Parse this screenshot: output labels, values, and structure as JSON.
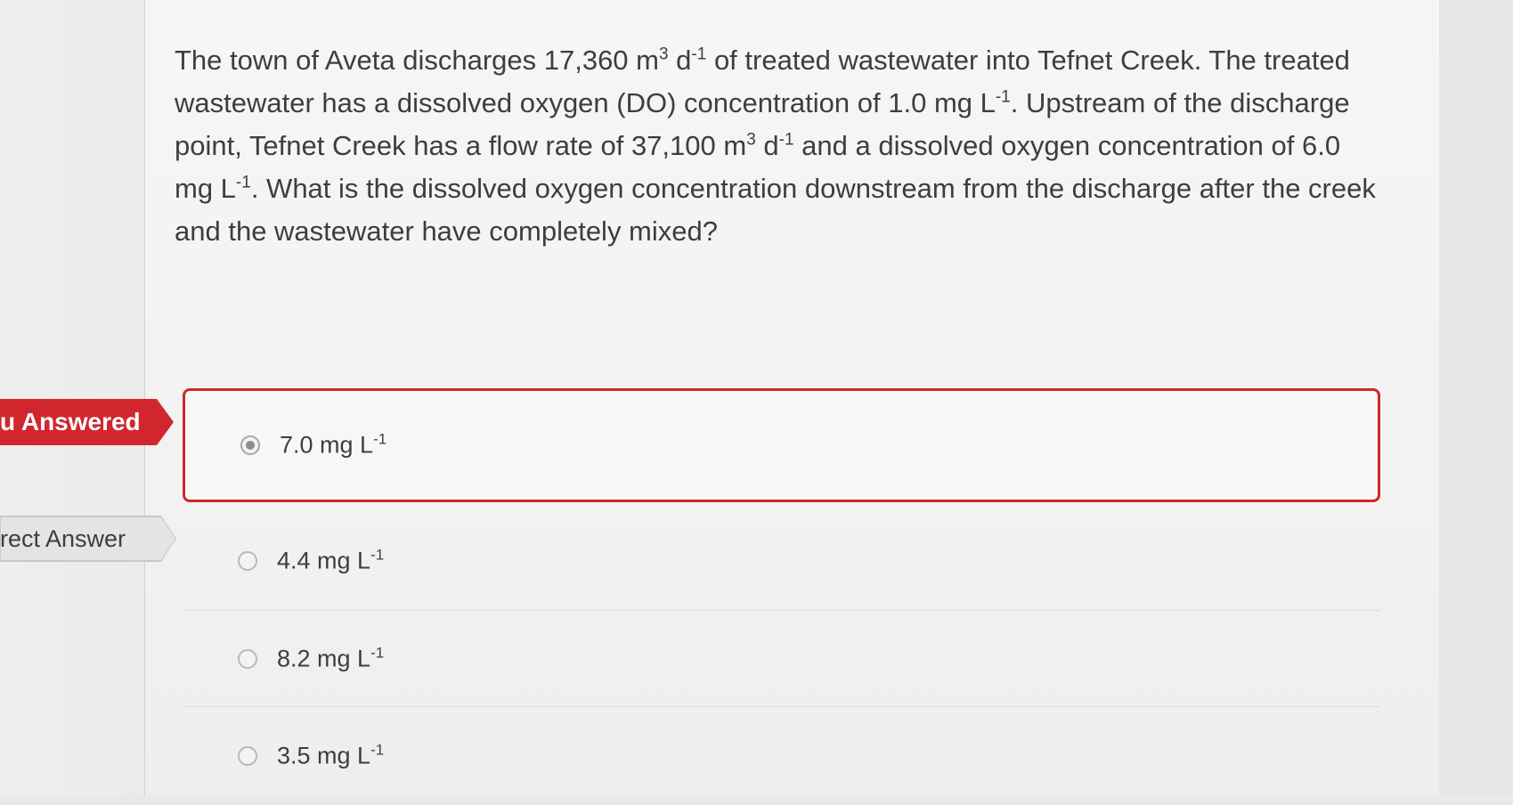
{
  "question": {
    "part1": "The town of Aveta discharges 17,360 m",
    "sup1": "3",
    "part2": " d",
    "sup2": "-1",
    "part3": " of treated wastewater into Tefnet Creek. The treated wastewater has a dissolved oxygen (DO) concentration of 1.0 mg L",
    "sup3": "-1",
    "part4": ". Upstream of the discharge point, Tefnet Creek has a flow rate of 37,100 m",
    "sup4": "3",
    "part5": " d",
    "sup5": "-1",
    "part6": " and a dissolved oxygen concentration of 6.0 mg L",
    "sup6": "-1",
    "part7": ". What is the dissolved oxygen concentration downstream from the discharge after the creek and the wastewater have completely mixed?"
  },
  "labels": {
    "answered": "u Answered",
    "correct": "rect Answer"
  },
  "options": [
    {
      "value": "7.0 mg L",
      "exp": "-1",
      "selected": true
    },
    {
      "value": "4.4 mg L",
      "exp": "-1",
      "selected": false
    },
    {
      "value": "8.2 mg L",
      "exp": "-1",
      "selected": false
    },
    {
      "value": "3.5 mg L",
      "exp": "-1",
      "selected": false
    }
  ],
  "colors": {
    "answered_tag": "#d2262f",
    "correct_tag": "#e4e4e2",
    "selected_border": "#d2262f",
    "text": "#3b3e42"
  }
}
